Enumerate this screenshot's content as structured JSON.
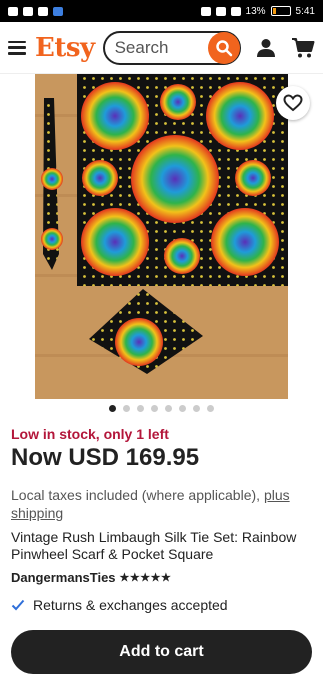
{
  "status_bar": {
    "battery": "13%",
    "time": "5:41"
  },
  "header": {
    "logo": "Etsy",
    "search_placeholder": "Search"
  },
  "gallery": {
    "image_count": 8,
    "active_index": 0,
    "favorite_icon": "heart-outline-icon"
  },
  "product": {
    "stock_notice": "Low in stock, only 1 left",
    "price": "Now USD 169.95",
    "taxes_text": "Local taxes included (where applicable),",
    "shipping_link": "plus shipping",
    "title": "Vintage Rush Limbaugh Silk Tie Set: Rainbow Pinwheel Scarf & Pocket Square",
    "shop_name": "DangermansTies",
    "rating_stars": "★★★★★",
    "returns": "Returns & exchanges accepted"
  },
  "actions": {
    "add_to_cart": "Add to cart"
  },
  "colors": {
    "brand": "#f1641e",
    "stock": "#b3163a",
    "button": "#222222"
  }
}
